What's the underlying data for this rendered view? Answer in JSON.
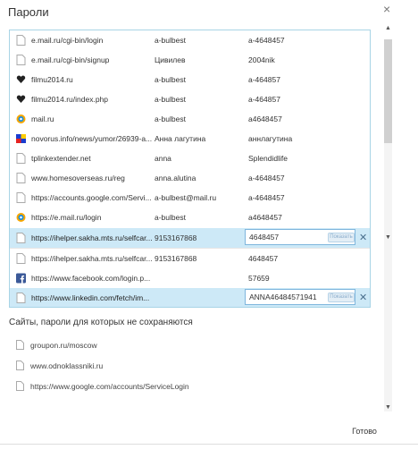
{
  "dialog": {
    "title": "Пароли",
    "close_symbol": "×",
    "done_label": "Готово"
  },
  "passwords": {
    "rows": [
      {
        "icon": "file-icon",
        "site": "e.mail.ru/cgi-bin/login",
        "user": "a-bulbest",
        "pass": "a-4648457"
      },
      {
        "icon": "file-icon",
        "site": "e.mail.ru/cgi-bin/signup",
        "user": "Цивилев",
        "pass": "2004nik"
      },
      {
        "icon": "heart-icon",
        "site": "filmu2014.ru",
        "user": "a-bulbest",
        "pass": "a-464857"
      },
      {
        "icon": "heart-icon",
        "site": "filmu2014.ru/index.php",
        "user": "a-bulbest",
        "pass": "a-464857"
      },
      {
        "icon": "mail-ru-icon",
        "site": "mail.ru",
        "user": "a-bulbest",
        "pass": "a4648457"
      },
      {
        "icon": "novorus-icon",
        "site": "novorus.info/news/yumor/26939-a...",
        "user": "Анна лагутина",
        "pass": "аннлагутина"
      },
      {
        "icon": "file-icon",
        "site": "tplinkextender.net",
        "user": "anna",
        "pass": "Splendidlife"
      },
      {
        "icon": "file-icon",
        "site": "www.homesoverseas.ru/reg",
        "user": "anna.alutina",
        "pass": "a-4648457"
      },
      {
        "icon": "file-icon",
        "site": "https://accounts.google.com/Servi...",
        "user": "a-bulbest@mail.ru",
        "pass": "a-4648457"
      },
      {
        "icon": "mail-ru-icon",
        "site": "https://e.mail.ru/login",
        "user": "a-bulbest",
        "pass": "a4648457"
      },
      {
        "icon": "file-icon",
        "site": "https://ihelper.sakha.mts.ru/selfcar...",
        "user": "9153167868",
        "pass": "4648457"
      },
      {
        "icon": "file-icon",
        "site": "https://ihelper.sakha.mts.ru/selfcar...",
        "user": "9153167868",
        "pass": "4648457"
      },
      {
        "icon": "facebook-icon",
        "site": "https://www.facebook.com/login.p...",
        "user": "",
        "pass": "57659"
      },
      {
        "icon": "file-icon",
        "site": "https://www.linkedin.com/fetch/im...",
        "user": "",
        "pass": "ANNA46484571941"
      }
    ],
    "show_label": "Показать",
    "delete_symbol": "✕"
  },
  "exceptions": {
    "title": "Сайты, пароли для которых не сохраняются",
    "sites": [
      "groupon.ru/moscow",
      "www.odnoklassniki.ru",
      "https://www.google.com/accounts/ServiceLogin"
    ]
  },
  "scroll": {
    "up_symbol": "▲",
    "down_symbol": "▼"
  }
}
